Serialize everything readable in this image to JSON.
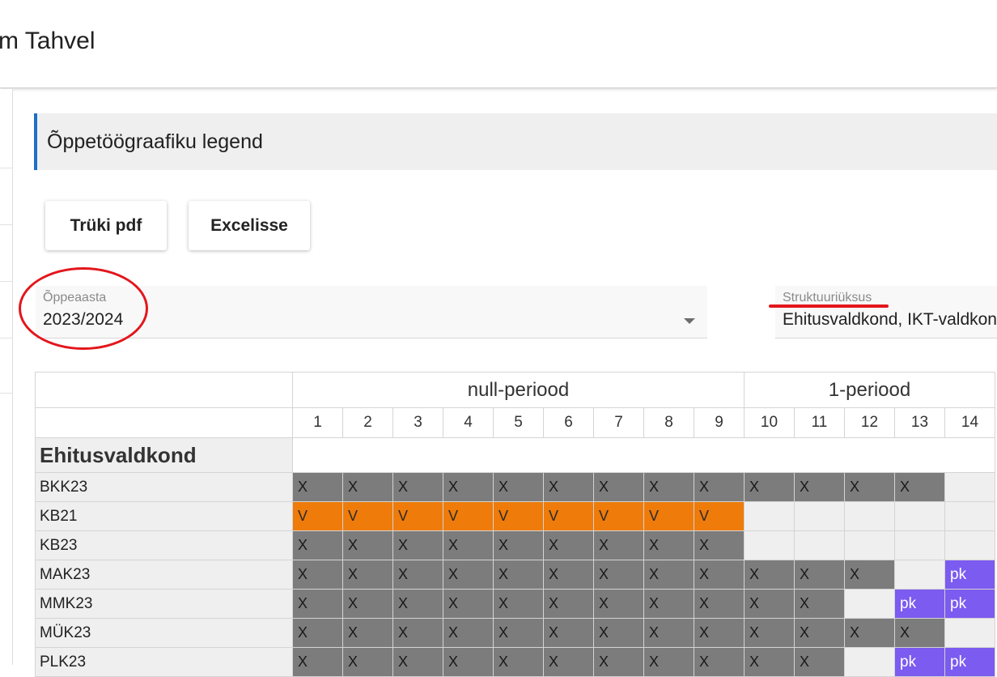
{
  "app": {
    "title": "m Tahvel"
  },
  "section": {
    "title": "Õppetöögraafiku legend"
  },
  "toolbar": {
    "print_pdf_label": "Trüki pdf",
    "excel_label": "Excelisse"
  },
  "filters": {
    "study_year": {
      "label": "Õppeaasta",
      "value": "2023/2024"
    },
    "structural_unit": {
      "label": "Struktuuriüksus",
      "value": "Ehitusvaldkond, IKT-valdkon"
    }
  },
  "annotations": {
    "mark_color": "#e3161c"
  },
  "colors": {
    "accent": "#1e6fc7",
    "cell_X": "#7c7c7c",
    "cell_V": "#ee7b0a",
    "cell_pk": "#7b5bf0",
    "cell_empty": "#efefef"
  },
  "schedule": {
    "periods": [
      {
        "name": "null-periood",
        "span": 9
      },
      {
        "name": "1-periood",
        "span": 5
      }
    ],
    "weeks": [
      "1",
      "2",
      "3",
      "4",
      "5",
      "6",
      "7",
      "8",
      "9",
      "10",
      "11",
      "12",
      "13",
      "14"
    ],
    "department": "Ehitusvaldkond",
    "groups": [
      {
        "name": "BKK23",
        "cells": [
          "X",
          "X",
          "X",
          "X",
          "X",
          "X",
          "X",
          "X",
          "X",
          "X",
          "X",
          "X",
          "X",
          ""
        ]
      },
      {
        "name": "KB21",
        "cells": [
          "V",
          "V",
          "V",
          "V",
          "V",
          "V",
          "V",
          "V",
          "V",
          "",
          "",
          "",
          "",
          ""
        ]
      },
      {
        "name": "KB23",
        "cells": [
          "X",
          "X",
          "X",
          "X",
          "X",
          "X",
          "X",
          "X",
          "X",
          "",
          "",
          "",
          "",
          ""
        ]
      },
      {
        "name": "MAK23",
        "cells": [
          "X",
          "X",
          "X",
          "X",
          "X",
          "X",
          "X",
          "X",
          "X",
          "X",
          "X",
          "X",
          "",
          "pk"
        ]
      },
      {
        "name": "MMK23",
        "cells": [
          "X",
          "X",
          "X",
          "X",
          "X",
          "X",
          "X",
          "X",
          "X",
          "X",
          "X",
          "",
          "pk",
          "pk"
        ]
      },
      {
        "name": "MÜK23",
        "cells": [
          "X",
          "X",
          "X",
          "X",
          "X",
          "X",
          "X",
          "X",
          "X",
          "X",
          "X",
          "X",
          "X",
          ""
        ]
      },
      {
        "name": "PLK23",
        "cells": [
          "X",
          "X",
          "X",
          "X",
          "X",
          "X",
          "X",
          "X",
          "X",
          "X",
          "X",
          "",
          "pk",
          "pk"
        ]
      }
    ]
  }
}
